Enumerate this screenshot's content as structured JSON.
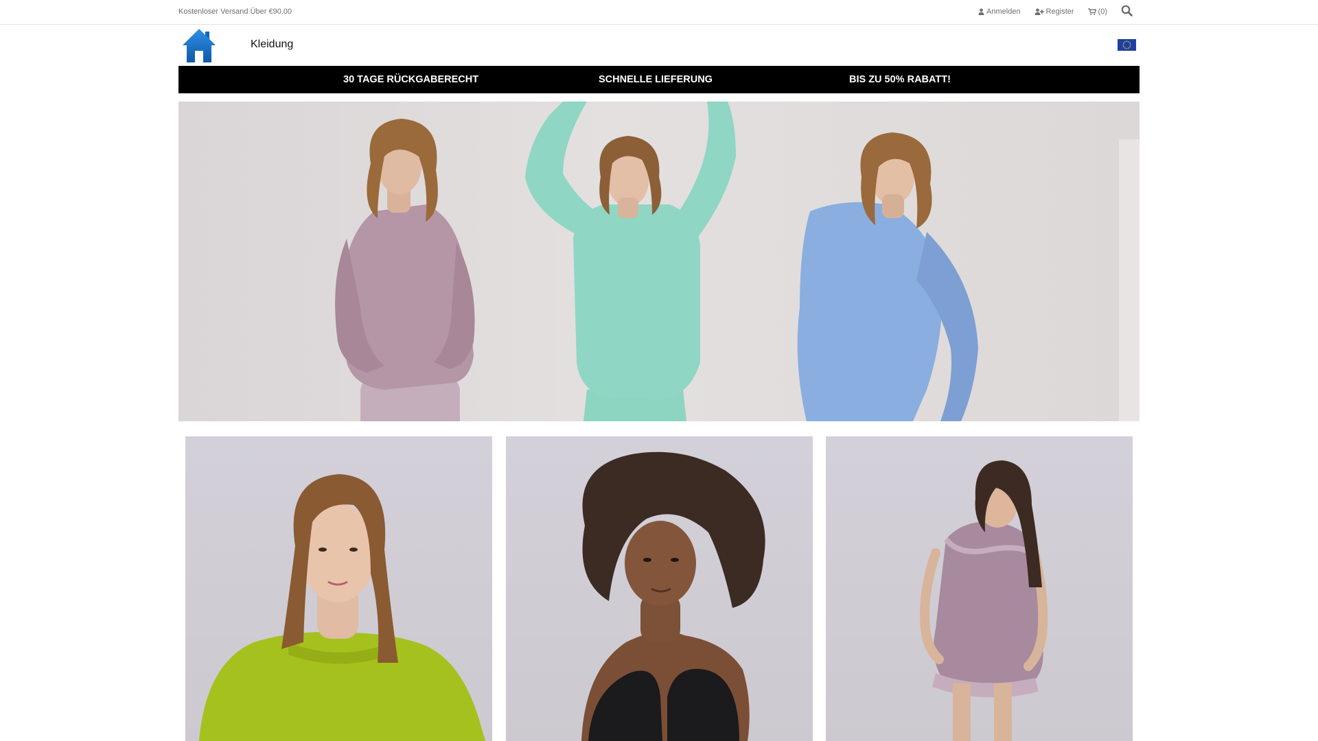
{
  "topbar": {
    "shipping_note": "Kostenloser Versand Über €90.00",
    "login_label": "Anmelden",
    "register_label": "Register",
    "cart_label": "(0)"
  },
  "header": {
    "category_link": "Kleidung",
    "flag_icon": "eu-flag-icon",
    "logo_icon": "home-icon"
  },
  "promo": {
    "items": [
      "30 TAGE RÜCKGABERECHT",
      "SCHNELLE LIEFERUNG",
      "BIS ZU 50% RABATT!"
    ]
  },
  "colors": {
    "logo_blue": "#1e6fc4",
    "promo_bg": "#000000",
    "promo_text": "#ffffff",
    "top_text": "#6e6e6e",
    "shirt_pink": "#b596a6",
    "shirt_mint": "#8fd6c4",
    "shirt_blue": "#8aaee0",
    "top_green": "#a5c11d",
    "bra_black": "#1b1a1c",
    "slip_mauve": "#a78a9e"
  },
  "icons": {
    "user": "user-icon",
    "register": "user-plus-icon",
    "cart": "cart-icon",
    "search": "search-icon"
  }
}
